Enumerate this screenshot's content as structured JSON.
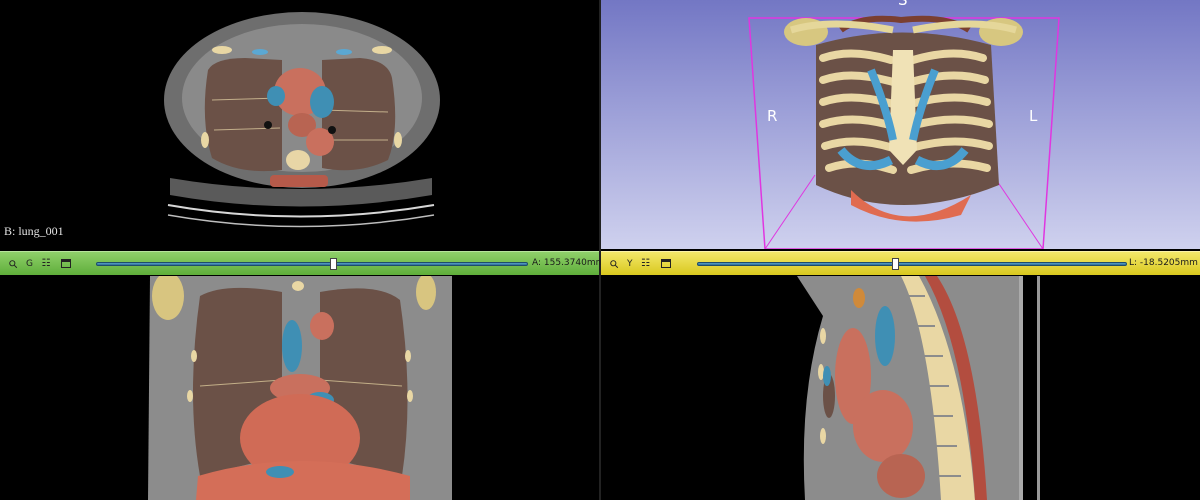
{
  "axial_view": {
    "volume_label": "B: lung_001"
  },
  "render_view": {
    "orientation_top": "S",
    "orientation_left": "R",
    "orientation_right": "L"
  },
  "green_slice_bar": {
    "view_letter": "G",
    "offset_text": "A: 155.3740mm",
    "slider_fraction": 0.55
  },
  "yellow_slice_bar": {
    "view_letter": "Y",
    "offset_text": "L: -18.5205mm",
    "slider_fraction": 0.46
  },
  "icons": [
    "pin-icon",
    "link-icon",
    "view-controls-icon",
    "maximize-view-icon"
  ],
  "colors": {
    "green_bar": "#6cbc45",
    "yellow_bar": "#e4d535",
    "render_background": "#8f93d2",
    "bounding_box": "#e036e0"
  }
}
